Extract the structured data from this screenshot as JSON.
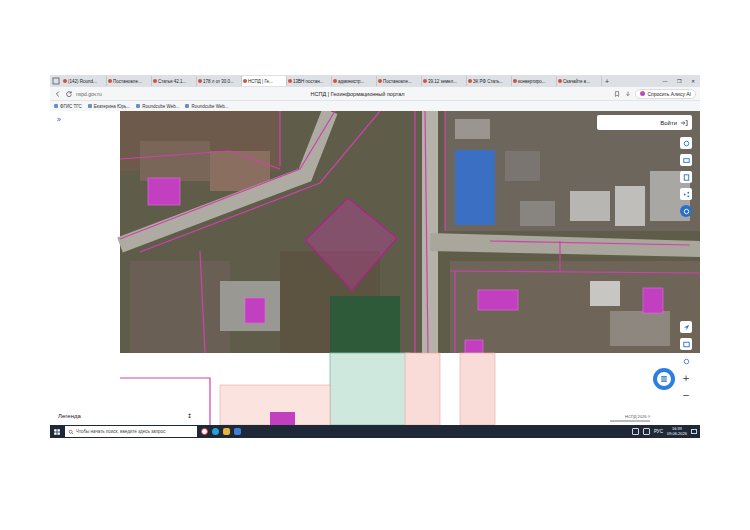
{
  "tabs": [
    {
      "label": "(142) Round...",
      "selected": false
    },
    {
      "label": "Постановле...",
      "selected": false
    },
    {
      "label": "Статья 42.1...",
      "selected": false
    },
    {
      "label": "178 л от 30.0...",
      "selected": false
    },
    {
      "label": "НСПД | Ге...",
      "selected": true
    },
    {
      "label": "13ВН постан...",
      "selected": false
    },
    {
      "label": "администр...",
      "selected": false
    },
    {
      "label": "Постановле...",
      "selected": false
    },
    {
      "label": "39.12 земел...",
      "selected": false
    },
    {
      "label": "ЗК РФ Стать...",
      "selected": false
    },
    {
      "label": "конвертиро...",
      "selected": false
    },
    {
      "label": "Скачайте в...",
      "selected": false
    }
  ],
  "new_tab": "+",
  "window_controls": [
    "—",
    "❐",
    "✕"
  ],
  "address_bar": {
    "url": "nspd.gov.ru",
    "page_title": "НСПД | Геоинформационный портал",
    "alice_button": "Спросить Алису AI"
  },
  "bookmarks": [
    "ФГИС ТГС",
    "Екатерина Юрь...",
    "Roundcube Web...",
    "Roundcube Web..."
  ],
  "sidebar": {
    "expand": "»"
  },
  "map": {
    "login": "Войти",
    "legend": "Легенда",
    "legend_toggle": "↕",
    "zoom": [
      "+",
      "−"
    ],
    "copyright": "НСПД 2026 ®"
  },
  "taskbar": {
    "search_placeholder": "Чтобы начать поиск, введите здесь запрос",
    "language": "РУС",
    "time": "16:39",
    "date": "09.06.2026"
  }
}
